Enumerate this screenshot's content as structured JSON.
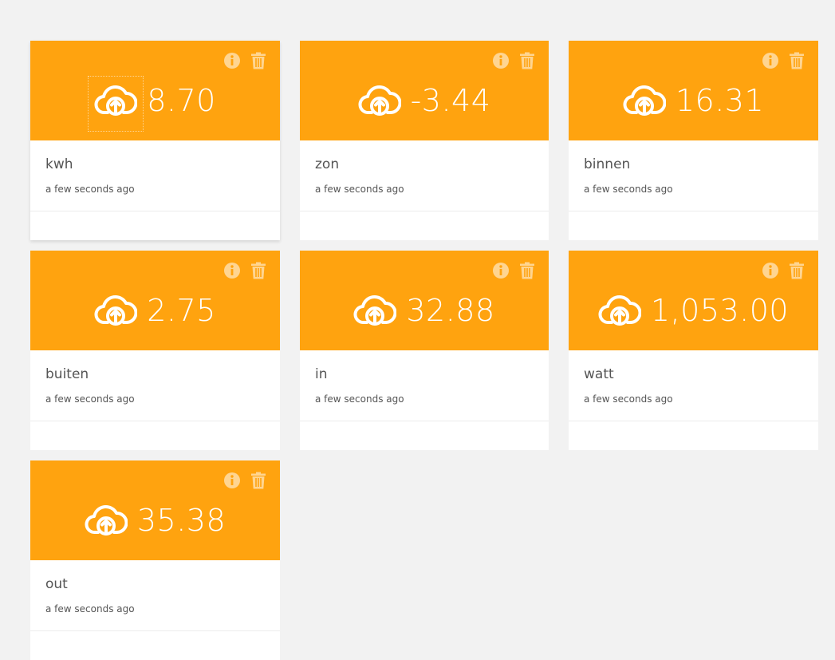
{
  "theme": {
    "accent": "#ffa30f",
    "page_bg": "#f2f2f2",
    "card_bg": "#ffffff",
    "icon_muted": "#ffd591"
  },
  "icons": {
    "value": "cloud-upload-icon",
    "info": "info-icon",
    "delete": "trash-icon"
  },
  "cards": [
    {
      "value": "8.70",
      "label": "kwh",
      "time": "a few seconds ago"
    },
    {
      "value": "-3.44",
      "label": "zon",
      "time": "a few seconds ago"
    },
    {
      "value": "16.31",
      "label": "binnen",
      "time": "a few seconds ago"
    },
    {
      "value": "2.75",
      "label": "buiten",
      "time": "a few seconds ago"
    },
    {
      "value": "32.88",
      "label": "in",
      "time": "a few seconds ago"
    },
    {
      "value": "1,053.00",
      "label": "watt",
      "time": "a few seconds ago"
    },
    {
      "value": "35.38",
      "label": "out",
      "time": "a few seconds ago"
    }
  ]
}
